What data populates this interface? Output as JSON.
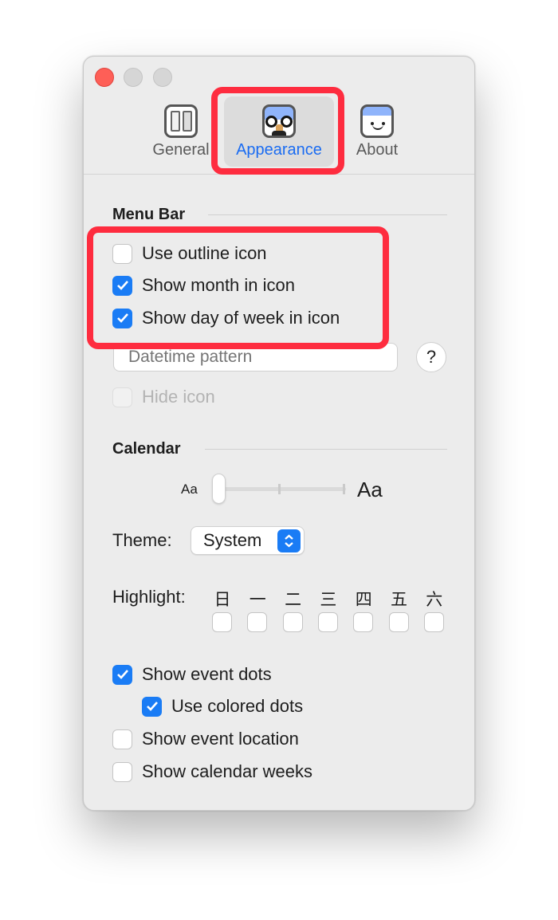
{
  "toolbar": {
    "tabs": [
      {
        "label": "General",
        "icon": "general-icon"
      },
      {
        "label": "Appearance",
        "icon": "disguise-face-icon",
        "selected": true
      },
      {
        "label": "About",
        "icon": "smiley-calendar-icon"
      }
    ]
  },
  "menu_bar": {
    "title": "Menu Bar",
    "options": [
      {
        "label": "Use outline icon",
        "checked": false
      },
      {
        "label": "Show month in icon",
        "checked": true
      },
      {
        "label": "Show day of week in icon",
        "checked": true
      }
    ],
    "datetime_placeholder": "Datetime pattern",
    "help_label": "?",
    "hide_icon": {
      "label": "Hide icon",
      "checked": false,
      "disabled": true
    }
  },
  "calendar": {
    "title": "Calendar",
    "size_small_label": "Aa",
    "size_large_label": "Aa",
    "size_slider": {
      "value": 0,
      "steps": 3
    },
    "theme_label": "Theme:",
    "theme_value": "System",
    "highlight_label": "Highlight:",
    "days": [
      "日",
      "一",
      "二",
      "三",
      "四",
      "五",
      "六"
    ],
    "options": [
      {
        "label": "Show event dots",
        "checked": true
      },
      {
        "label": "Use colored dots",
        "checked": true,
        "indent": true
      },
      {
        "label": "Show event location",
        "checked": false
      },
      {
        "label": "Show calendar weeks",
        "checked": false
      }
    ]
  },
  "colors": {
    "accent": "#1a7cf5",
    "annotation": "#fe2c3f",
    "close": "#fe5f57"
  }
}
